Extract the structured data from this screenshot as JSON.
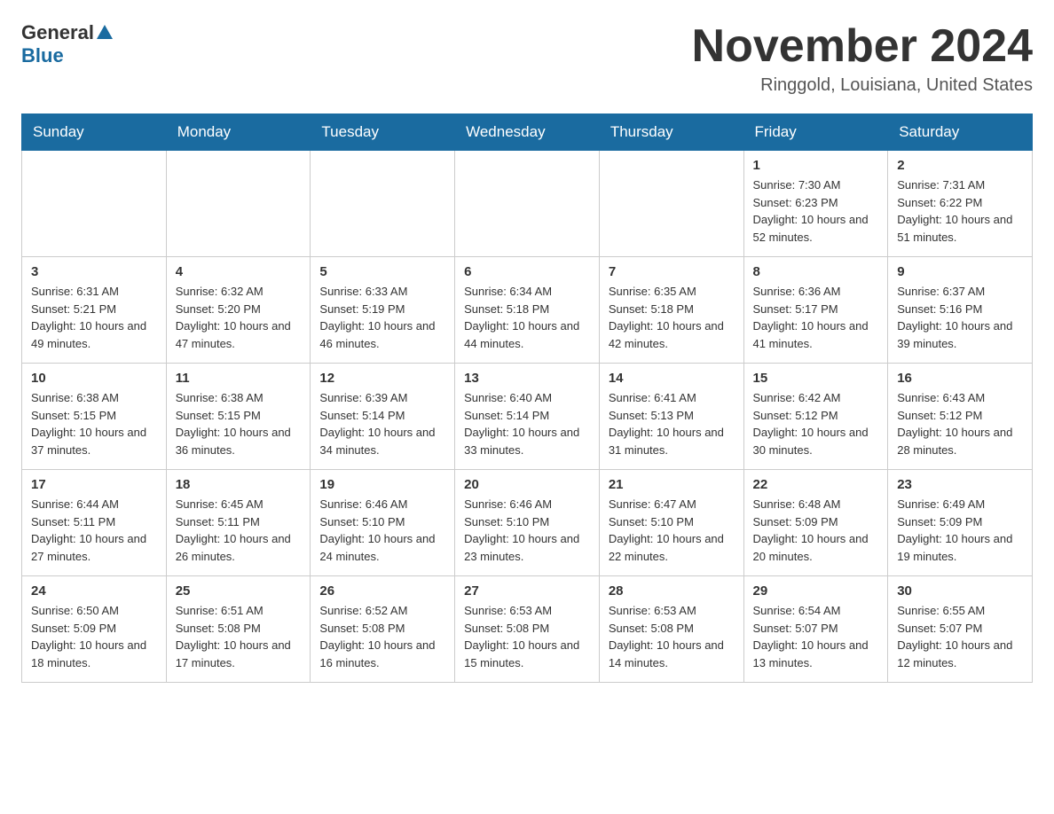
{
  "header": {
    "logo_general": "General",
    "logo_blue": "Blue",
    "title": "November 2024",
    "subtitle": "Ringgold, Louisiana, United States"
  },
  "days_of_week": [
    "Sunday",
    "Monday",
    "Tuesday",
    "Wednesday",
    "Thursday",
    "Friday",
    "Saturday"
  ],
  "weeks": [
    [
      {
        "day": "",
        "sunrise": "",
        "sunset": "",
        "daylight": ""
      },
      {
        "day": "",
        "sunrise": "",
        "sunset": "",
        "daylight": ""
      },
      {
        "day": "",
        "sunrise": "",
        "sunset": "",
        "daylight": ""
      },
      {
        "day": "",
        "sunrise": "",
        "sunset": "",
        "daylight": ""
      },
      {
        "day": "",
        "sunrise": "",
        "sunset": "",
        "daylight": ""
      },
      {
        "day": "1",
        "sunrise": "Sunrise: 7:30 AM",
        "sunset": "Sunset: 6:23 PM",
        "daylight": "Daylight: 10 hours and 52 minutes."
      },
      {
        "day": "2",
        "sunrise": "Sunrise: 7:31 AM",
        "sunset": "Sunset: 6:22 PM",
        "daylight": "Daylight: 10 hours and 51 minutes."
      }
    ],
    [
      {
        "day": "3",
        "sunrise": "Sunrise: 6:31 AM",
        "sunset": "Sunset: 5:21 PM",
        "daylight": "Daylight: 10 hours and 49 minutes."
      },
      {
        "day": "4",
        "sunrise": "Sunrise: 6:32 AM",
        "sunset": "Sunset: 5:20 PM",
        "daylight": "Daylight: 10 hours and 47 minutes."
      },
      {
        "day": "5",
        "sunrise": "Sunrise: 6:33 AM",
        "sunset": "Sunset: 5:19 PM",
        "daylight": "Daylight: 10 hours and 46 minutes."
      },
      {
        "day": "6",
        "sunrise": "Sunrise: 6:34 AM",
        "sunset": "Sunset: 5:18 PM",
        "daylight": "Daylight: 10 hours and 44 minutes."
      },
      {
        "day": "7",
        "sunrise": "Sunrise: 6:35 AM",
        "sunset": "Sunset: 5:18 PM",
        "daylight": "Daylight: 10 hours and 42 minutes."
      },
      {
        "day": "8",
        "sunrise": "Sunrise: 6:36 AM",
        "sunset": "Sunset: 5:17 PM",
        "daylight": "Daylight: 10 hours and 41 minutes."
      },
      {
        "day": "9",
        "sunrise": "Sunrise: 6:37 AM",
        "sunset": "Sunset: 5:16 PM",
        "daylight": "Daylight: 10 hours and 39 minutes."
      }
    ],
    [
      {
        "day": "10",
        "sunrise": "Sunrise: 6:38 AM",
        "sunset": "Sunset: 5:15 PM",
        "daylight": "Daylight: 10 hours and 37 minutes."
      },
      {
        "day": "11",
        "sunrise": "Sunrise: 6:38 AM",
        "sunset": "Sunset: 5:15 PM",
        "daylight": "Daylight: 10 hours and 36 minutes."
      },
      {
        "day": "12",
        "sunrise": "Sunrise: 6:39 AM",
        "sunset": "Sunset: 5:14 PM",
        "daylight": "Daylight: 10 hours and 34 minutes."
      },
      {
        "day": "13",
        "sunrise": "Sunrise: 6:40 AM",
        "sunset": "Sunset: 5:14 PM",
        "daylight": "Daylight: 10 hours and 33 minutes."
      },
      {
        "day": "14",
        "sunrise": "Sunrise: 6:41 AM",
        "sunset": "Sunset: 5:13 PM",
        "daylight": "Daylight: 10 hours and 31 minutes."
      },
      {
        "day": "15",
        "sunrise": "Sunrise: 6:42 AM",
        "sunset": "Sunset: 5:12 PM",
        "daylight": "Daylight: 10 hours and 30 minutes."
      },
      {
        "day": "16",
        "sunrise": "Sunrise: 6:43 AM",
        "sunset": "Sunset: 5:12 PM",
        "daylight": "Daylight: 10 hours and 28 minutes."
      }
    ],
    [
      {
        "day": "17",
        "sunrise": "Sunrise: 6:44 AM",
        "sunset": "Sunset: 5:11 PM",
        "daylight": "Daylight: 10 hours and 27 minutes."
      },
      {
        "day": "18",
        "sunrise": "Sunrise: 6:45 AM",
        "sunset": "Sunset: 5:11 PM",
        "daylight": "Daylight: 10 hours and 26 minutes."
      },
      {
        "day": "19",
        "sunrise": "Sunrise: 6:46 AM",
        "sunset": "Sunset: 5:10 PM",
        "daylight": "Daylight: 10 hours and 24 minutes."
      },
      {
        "day": "20",
        "sunrise": "Sunrise: 6:46 AM",
        "sunset": "Sunset: 5:10 PM",
        "daylight": "Daylight: 10 hours and 23 minutes."
      },
      {
        "day": "21",
        "sunrise": "Sunrise: 6:47 AM",
        "sunset": "Sunset: 5:10 PM",
        "daylight": "Daylight: 10 hours and 22 minutes."
      },
      {
        "day": "22",
        "sunrise": "Sunrise: 6:48 AM",
        "sunset": "Sunset: 5:09 PM",
        "daylight": "Daylight: 10 hours and 20 minutes."
      },
      {
        "day": "23",
        "sunrise": "Sunrise: 6:49 AM",
        "sunset": "Sunset: 5:09 PM",
        "daylight": "Daylight: 10 hours and 19 minutes."
      }
    ],
    [
      {
        "day": "24",
        "sunrise": "Sunrise: 6:50 AM",
        "sunset": "Sunset: 5:09 PM",
        "daylight": "Daylight: 10 hours and 18 minutes."
      },
      {
        "day": "25",
        "sunrise": "Sunrise: 6:51 AM",
        "sunset": "Sunset: 5:08 PM",
        "daylight": "Daylight: 10 hours and 17 minutes."
      },
      {
        "day": "26",
        "sunrise": "Sunrise: 6:52 AM",
        "sunset": "Sunset: 5:08 PM",
        "daylight": "Daylight: 10 hours and 16 minutes."
      },
      {
        "day": "27",
        "sunrise": "Sunrise: 6:53 AM",
        "sunset": "Sunset: 5:08 PM",
        "daylight": "Daylight: 10 hours and 15 minutes."
      },
      {
        "day": "28",
        "sunrise": "Sunrise: 6:53 AM",
        "sunset": "Sunset: 5:08 PM",
        "daylight": "Daylight: 10 hours and 14 minutes."
      },
      {
        "day": "29",
        "sunrise": "Sunrise: 6:54 AM",
        "sunset": "Sunset: 5:07 PM",
        "daylight": "Daylight: 10 hours and 13 minutes."
      },
      {
        "day": "30",
        "sunrise": "Sunrise: 6:55 AM",
        "sunset": "Sunset: 5:07 PM",
        "daylight": "Daylight: 10 hours and 12 minutes."
      }
    ]
  ]
}
